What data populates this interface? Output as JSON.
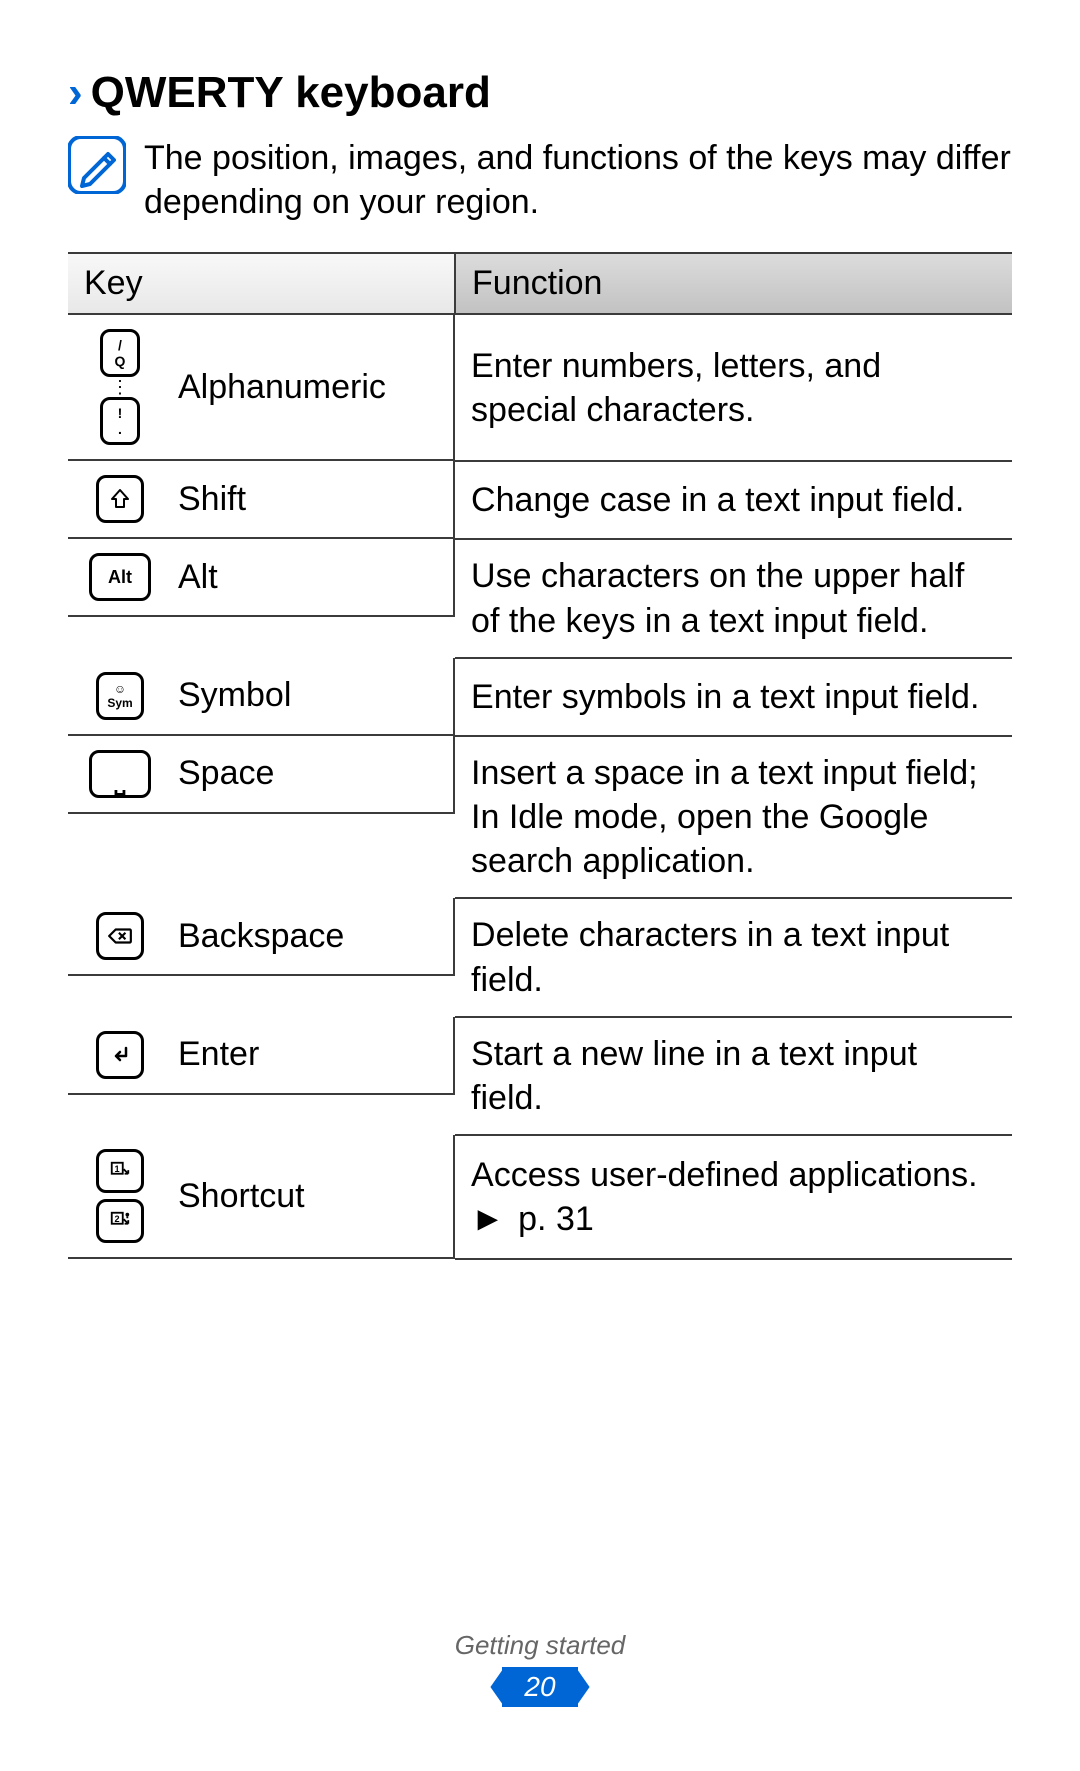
{
  "heading": {
    "bullet": "›",
    "title": "QWERTY keyboard"
  },
  "note": "The position, images, and functions of the keys may differ depending on your region.",
  "table": {
    "headers": {
      "key": "Key",
      "fn": "Function"
    },
    "rows": [
      {
        "name": "Alphanumeric",
        "fn": "Enter numbers, letters, and special characters."
      },
      {
        "name": "Shift",
        "fn": "Change case in a text input field."
      },
      {
        "name": "Alt",
        "fn": "Use characters on the upper half of the keys in a text input field."
      },
      {
        "name": "Symbol",
        "fn": "Enter symbols in a text input field."
      },
      {
        "name": "Space",
        "fn": "Insert a space in a text input field; In Idle mode, open the Google search application."
      },
      {
        "name": "Backspace",
        "fn": "Delete characters in a text input field."
      },
      {
        "name": "Enter",
        "fn": "Start a new line in a text input field."
      },
      {
        "name": "Shortcut",
        "fn": "Access user-defined applications.",
        "cross_ref": "p. 31",
        "cross_ref_arrow": "►"
      }
    ]
  },
  "key_labels": {
    "alpha_top_upper": "/",
    "alpha_top_lower": "Q",
    "alpha_bot_upper": "!",
    "alpha_bot_lower": ".",
    "alt": "Alt",
    "sym_upper": "☺",
    "sym_lower": "Sym"
  },
  "footer": {
    "section": "Getting started",
    "page": "20"
  }
}
